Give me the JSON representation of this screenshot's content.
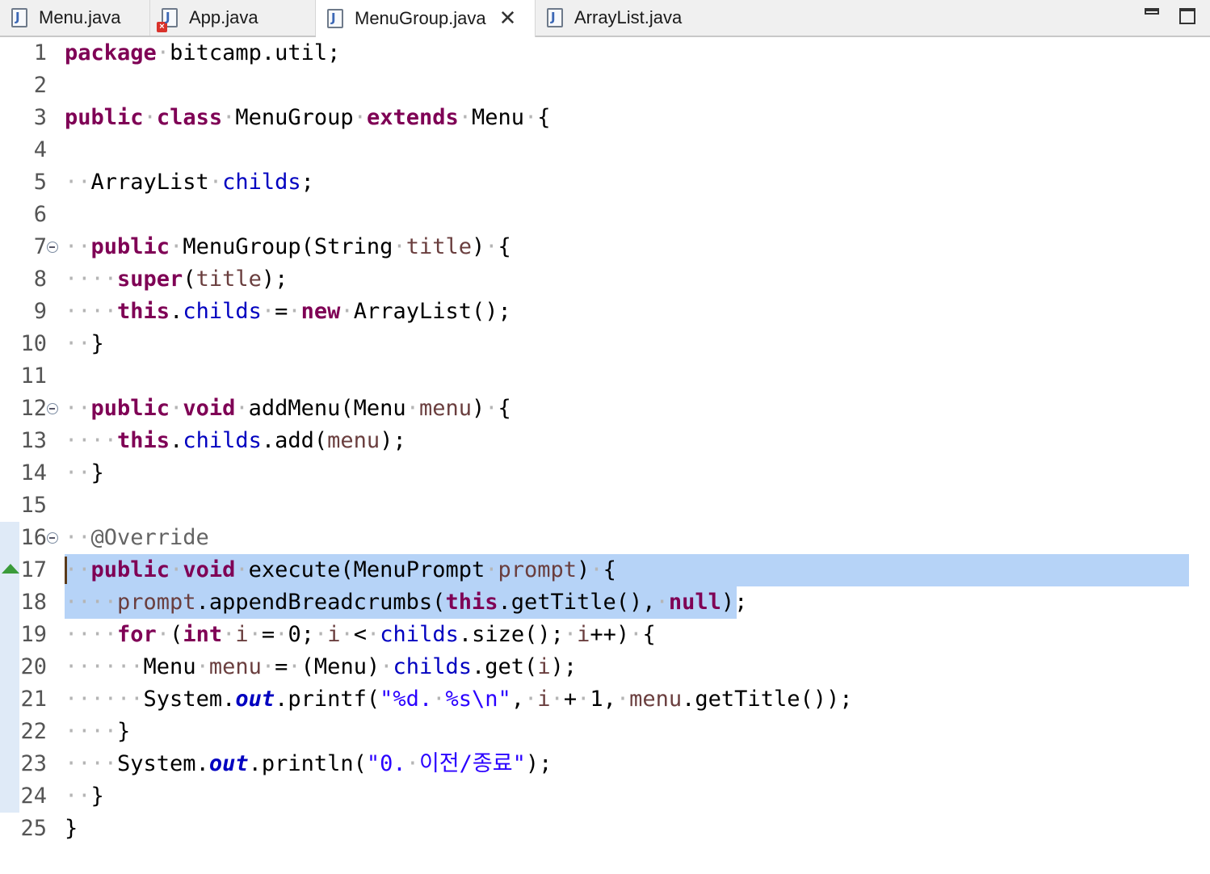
{
  "tabs": [
    {
      "label": "Menu.java",
      "active": false,
      "error": false
    },
    {
      "label": "App.java",
      "active": false,
      "error": true
    },
    {
      "label": "MenuGroup.java",
      "active": true,
      "error": false
    },
    {
      "label": "ArrayList.java",
      "active": false,
      "error": false
    }
  ],
  "window_controls": {
    "minimize": "minimize-icon",
    "maximize": "maximize-icon"
  },
  "editor": {
    "line_numbers": [
      "1",
      "2",
      "3",
      "4",
      "5",
      "6",
      "7",
      "8",
      "9",
      "10",
      "11",
      "12",
      "13",
      "14",
      "15",
      "16",
      "17",
      "18",
      "19",
      "20",
      "21",
      "22",
      "23",
      "24",
      "25"
    ],
    "lines": [
      [
        [
          "kw",
          "package"
        ],
        [
          "ws",
          "·"
        ],
        [
          "t",
          "bitcamp.util;"
        ]
      ],
      [],
      [
        [
          "kw",
          "public"
        ],
        [
          "ws",
          "·"
        ],
        [
          "kw",
          "class"
        ],
        [
          "ws",
          "·"
        ],
        [
          "t",
          "MenuGroup"
        ],
        [
          "ws",
          "·"
        ],
        [
          "kw",
          "extends"
        ],
        [
          "ws",
          "·"
        ],
        [
          "t",
          "Menu"
        ],
        [
          "ws",
          "·"
        ],
        [
          "t",
          "{"
        ]
      ],
      [],
      [
        [
          "ws",
          "··"
        ],
        [
          "t",
          "ArrayList"
        ],
        [
          "ws",
          "·"
        ],
        [
          "fld",
          "childs"
        ],
        [
          "t",
          ";"
        ]
      ],
      [],
      [
        [
          "ws",
          "··"
        ],
        [
          "kw",
          "public"
        ],
        [
          "ws",
          "·"
        ],
        [
          "t",
          "MenuGroup(String"
        ],
        [
          "ws",
          "·"
        ],
        [
          "var",
          "title"
        ],
        [
          "t",
          ")"
        ],
        [
          "ws",
          "·"
        ],
        [
          "t",
          "{"
        ]
      ],
      [
        [
          "ws",
          "····"
        ],
        [
          "kw",
          "super"
        ],
        [
          "t",
          "("
        ],
        [
          "var",
          "title"
        ],
        [
          "t",
          ");"
        ]
      ],
      [
        [
          "ws",
          "····"
        ],
        [
          "kw",
          "this"
        ],
        [
          "t",
          "."
        ],
        [
          "fld",
          "childs"
        ],
        [
          "ws",
          "·"
        ],
        [
          "t",
          "="
        ],
        [
          "ws",
          "·"
        ],
        [
          "kw",
          "new"
        ],
        [
          "ws",
          "·"
        ],
        [
          "t",
          "ArrayList();"
        ]
      ],
      [
        [
          "ws",
          "··"
        ],
        [
          "t",
          "}"
        ]
      ],
      [],
      [
        [
          "ws",
          "··"
        ],
        [
          "kw",
          "public"
        ],
        [
          "ws",
          "·"
        ],
        [
          "kw",
          "void"
        ],
        [
          "ws",
          "·"
        ],
        [
          "t",
          "addMenu(Menu"
        ],
        [
          "ws",
          "·"
        ],
        [
          "var",
          "menu"
        ],
        [
          "t",
          ")"
        ],
        [
          "ws",
          "·"
        ],
        [
          "t",
          "{"
        ]
      ],
      [
        [
          "ws",
          "····"
        ],
        [
          "kw",
          "this"
        ],
        [
          "t",
          "."
        ],
        [
          "fld",
          "childs"
        ],
        [
          "t",
          ".add("
        ],
        [
          "var",
          "menu"
        ],
        [
          "t",
          ");"
        ]
      ],
      [
        [
          "ws",
          "··"
        ],
        [
          "t",
          "}"
        ]
      ],
      [],
      [
        [
          "ws",
          "··"
        ],
        [
          "ann",
          "@Override"
        ]
      ],
      [
        [
          "ws",
          "··"
        ],
        [
          "kw",
          "public"
        ],
        [
          "ws",
          "·"
        ],
        [
          "kw",
          "void"
        ],
        [
          "ws",
          "·"
        ],
        [
          "t",
          "execute(MenuPrompt"
        ],
        [
          "ws",
          "·"
        ],
        [
          "var",
          "prompt"
        ],
        [
          "t",
          ")"
        ],
        [
          "ws",
          "·"
        ],
        [
          "t",
          "{"
        ]
      ],
      [
        [
          "ws",
          "····"
        ],
        [
          "var",
          "prompt"
        ],
        [
          "t",
          ".appendBreadcrumbs("
        ],
        [
          "kw",
          "this"
        ],
        [
          "t",
          ".getTitle(),"
        ],
        [
          "ws",
          "·"
        ],
        [
          "kw",
          "null"
        ],
        [
          "t",
          ");"
        ]
      ],
      [
        [
          "ws",
          "····"
        ],
        [
          "kw",
          "for"
        ],
        [
          "ws",
          "·"
        ],
        [
          "t",
          "("
        ],
        [
          "kw",
          "int"
        ],
        [
          "ws",
          "·"
        ],
        [
          "var",
          "i"
        ],
        [
          "ws",
          "·"
        ],
        [
          "t",
          "="
        ],
        [
          "ws",
          "·"
        ],
        [
          "t",
          "0;"
        ],
        [
          "ws",
          "·"
        ],
        [
          "var",
          "i"
        ],
        [
          "ws",
          "·"
        ],
        [
          "t",
          "<"
        ],
        [
          "ws",
          "·"
        ],
        [
          "fld",
          "childs"
        ],
        [
          "t",
          ".size();"
        ],
        [
          "ws",
          "·"
        ],
        [
          "var",
          "i"
        ],
        [
          "t",
          "++)"
        ],
        [
          "ws",
          "·"
        ],
        [
          "t",
          "{"
        ]
      ],
      [
        [
          "ws",
          "······"
        ],
        [
          "t",
          "Menu"
        ],
        [
          "ws",
          "·"
        ],
        [
          "var",
          "menu"
        ],
        [
          "ws",
          "·"
        ],
        [
          "t",
          "="
        ],
        [
          "ws",
          "·"
        ],
        [
          "t",
          "(Menu)"
        ],
        [
          "ws",
          "·"
        ],
        [
          "fld",
          "childs"
        ],
        [
          "t",
          ".get("
        ],
        [
          "var",
          "i"
        ],
        [
          "t",
          ");"
        ]
      ],
      [
        [
          "ws",
          "······"
        ],
        [
          "t",
          "System."
        ],
        [
          "stat",
          "out"
        ],
        [
          "t",
          ".printf("
        ],
        [
          "str",
          "\"%d."
        ],
        [
          "ws",
          "·"
        ],
        [
          "str",
          "%s\\n\""
        ],
        [
          "t",
          ","
        ],
        [
          "ws",
          "·"
        ],
        [
          "var",
          "i"
        ],
        [
          "ws",
          "·"
        ],
        [
          "t",
          "+"
        ],
        [
          "ws",
          "·"
        ],
        [
          "t",
          "1,"
        ],
        [
          "ws",
          "·"
        ],
        [
          "var",
          "menu"
        ],
        [
          "t",
          ".getTitle());"
        ]
      ],
      [
        [
          "ws",
          "····"
        ],
        [
          "t",
          "}"
        ]
      ],
      [
        [
          "ws",
          "····"
        ],
        [
          "t",
          "System."
        ],
        [
          "stat",
          "out"
        ],
        [
          "t",
          ".println("
        ],
        [
          "str",
          "\"0."
        ],
        [
          "ws",
          "·"
        ],
        [
          "str",
          "이전/종료\""
        ],
        [
          "t",
          ");"
        ]
      ],
      [
        [
          "ws",
          "··"
        ],
        [
          "t",
          "}"
        ]
      ],
      [
        [
          "t",
          "}"
        ]
      ]
    ]
  }
}
